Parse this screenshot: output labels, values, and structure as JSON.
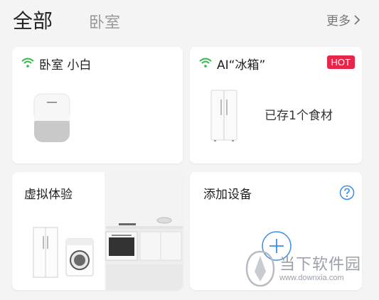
{
  "tabs": {
    "all": "全部",
    "bedroom": "卧室",
    "more": "更多"
  },
  "cards": {
    "bedroom_speaker": {
      "title": "卧室 小白"
    },
    "fridge": {
      "title": "AI“冰箱”",
      "badge": "HOT",
      "status": "已存1个食材"
    },
    "virtual": {
      "title": "虚拟体验"
    },
    "add_device": {
      "title": "添加设备"
    }
  },
  "watermark": {
    "text": "当下软件园",
    "url": "www.downxia.com"
  },
  "colors": {
    "accent": "#3a8ee6",
    "wifi": "#2fb84a",
    "hot": "#e8264a"
  }
}
